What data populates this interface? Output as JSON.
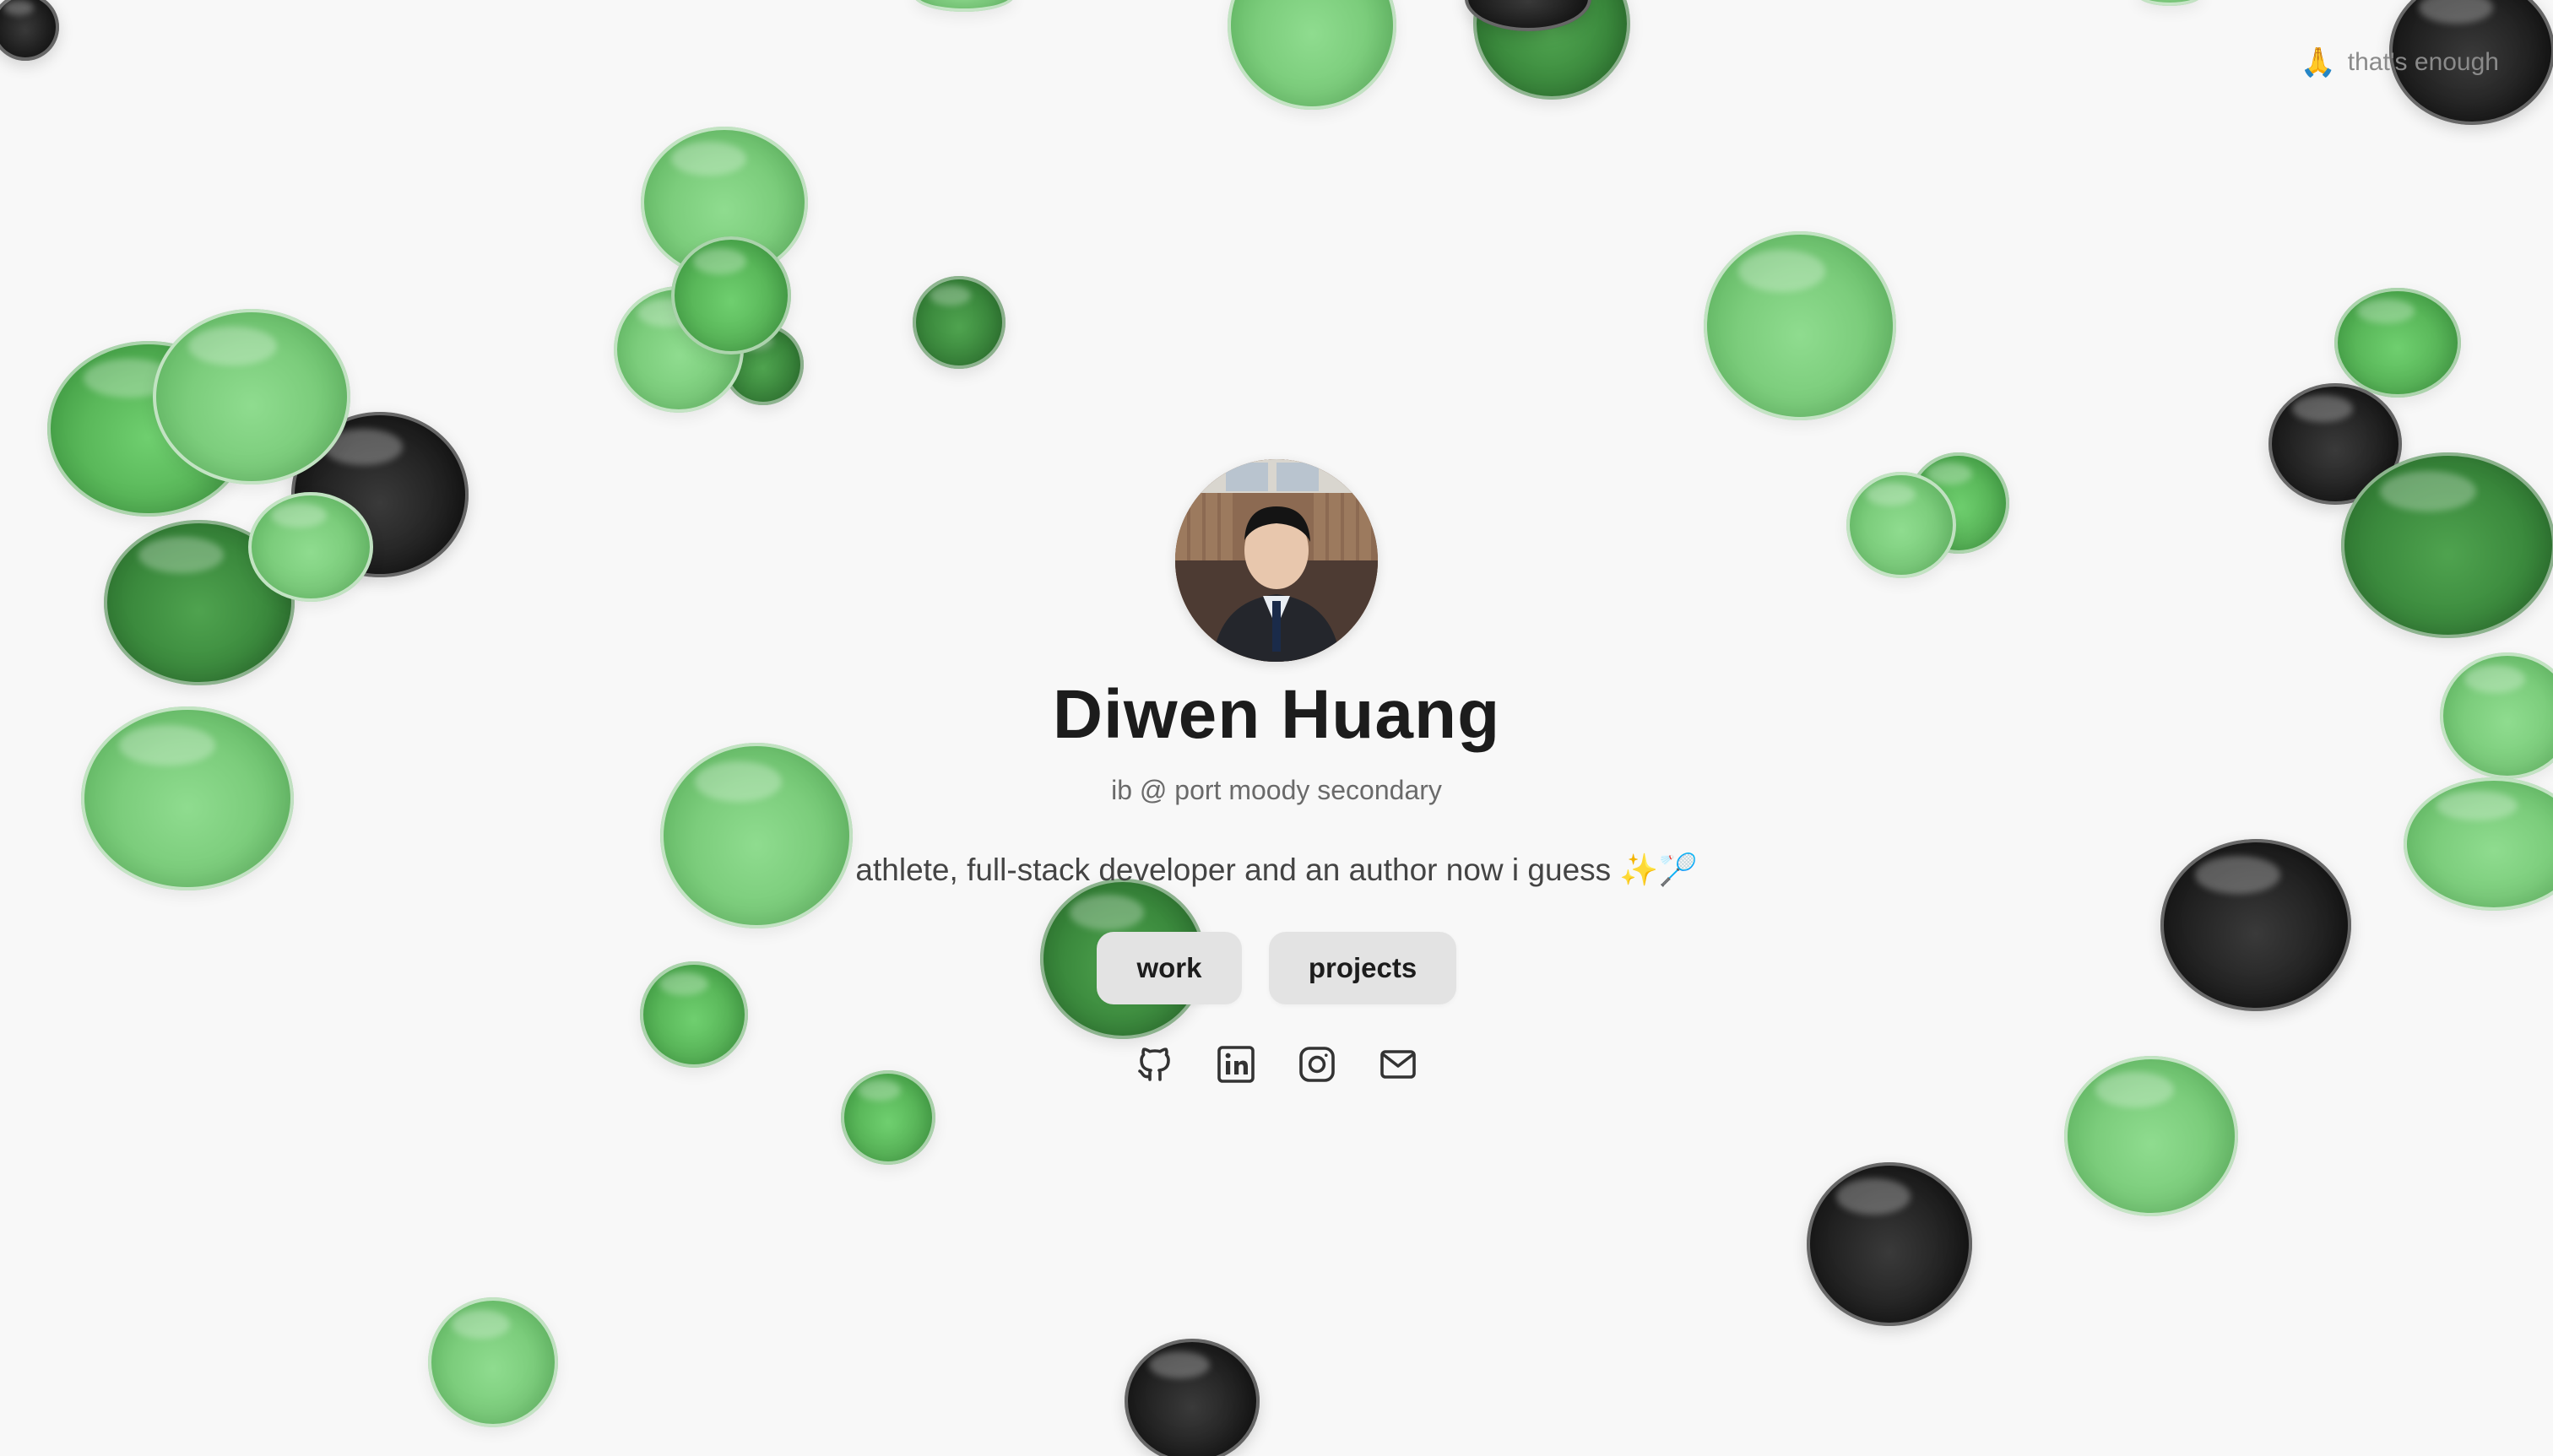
{
  "toggle": {
    "icon": "folded-hands-icon",
    "label": "that's enough"
  },
  "profile": {
    "name": "Diwen Huang",
    "school": "ib @ port moody secondary",
    "bio": "athlete, full-stack developer and an author now i guess ✨🏸"
  },
  "nav": {
    "work_label": "work",
    "projects_label": "projects"
  },
  "socials": [
    {
      "icon": "github-icon"
    },
    {
      "icon": "linkedin-icon"
    },
    {
      "icon": "instagram-icon"
    },
    {
      "icon": "mail-icon"
    }
  ],
  "colors": {
    "background": "#f8f8f8",
    "green": "#5ab85a",
    "light_green": "#7ccd7c",
    "dark_green": "#3b8a3d",
    "black": "#1a1a1a",
    "button_bg": "#e3e3e3",
    "text_primary": "#1c1c1c",
    "text_secondary": "#6a6a6a"
  }
}
